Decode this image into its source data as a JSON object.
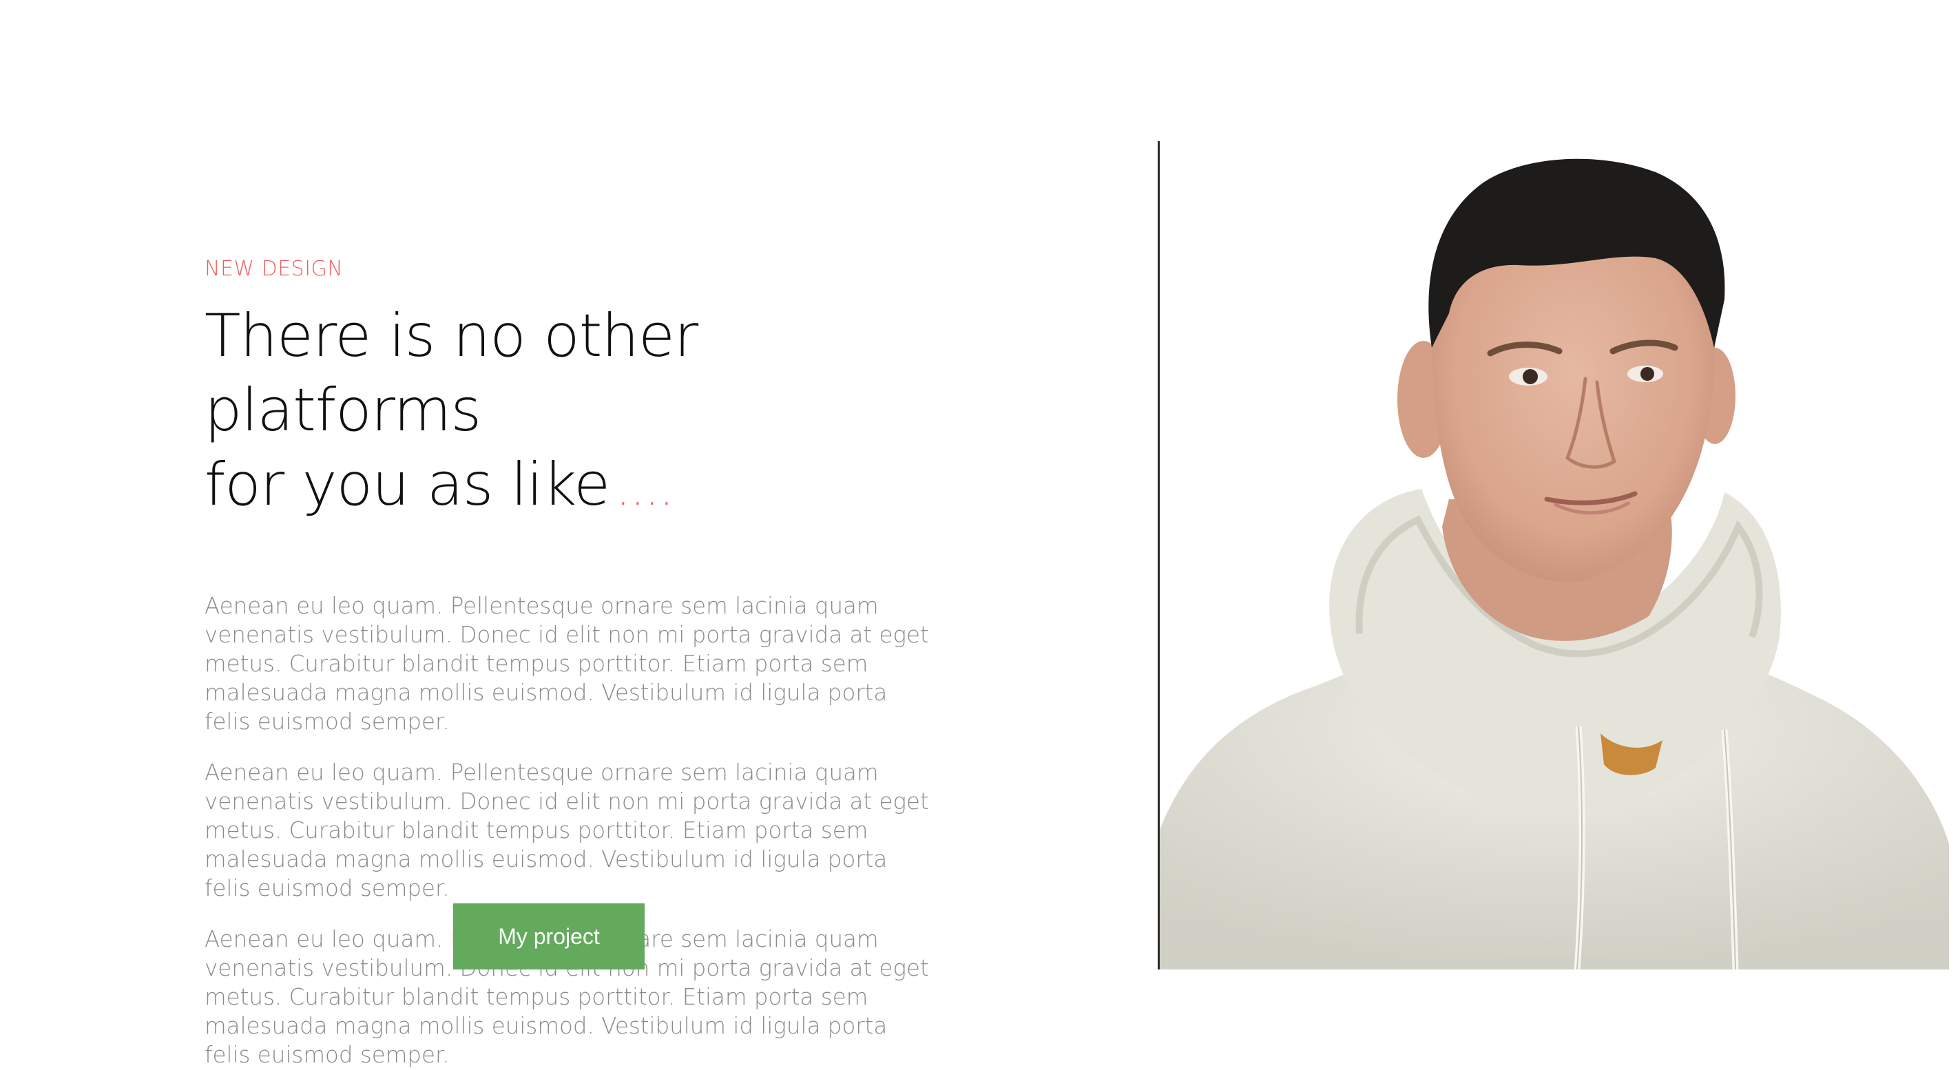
{
  "hero": {
    "eyebrow": "NEW DESIGN",
    "headline_line1": "There is no other platforms",
    "headline_line2": "for you as like",
    "headline_dots": "....",
    "paragraphs": [
      "Aenean eu leo quam. Pellentesque ornare sem lacinia quam venenatis vestibulum. Donec id elit non mi porta gravida at eget metus. Curabitur blandit tempus porttitor. Etiam porta sem malesuada magna mollis euismod. Vestibulum id ligula porta felis euismod semper.",
      "Aenean eu leo quam. Pellentesque ornare sem lacinia quam venenatis vestibulum. Donec id elit non mi porta gravida at eget metus. Curabitur blandit tempus porttitor. Etiam porta sem malesuada magna mollis euismod. Vestibulum id ligula porta felis euismod semper.",
      "Aenean eu leo quam. Pellentesque ornare sem lacinia quam venenatis vestibulum. Donec id elit non mi porta gravida at eget metus. Curabitur blandit tempus porttitor. Etiam porta sem malesuada magna mollis euismod. Vestibulum id ligula porta felis euismod semper."
    ],
    "cta_label": "My project"
  },
  "colors": {
    "accent": "#ee5f5b",
    "cta_background": "#64aa5c",
    "body_text": "#8a8a8a",
    "headline_text": "#111111"
  },
  "portrait": {
    "icon": "person-portrait-photo"
  }
}
